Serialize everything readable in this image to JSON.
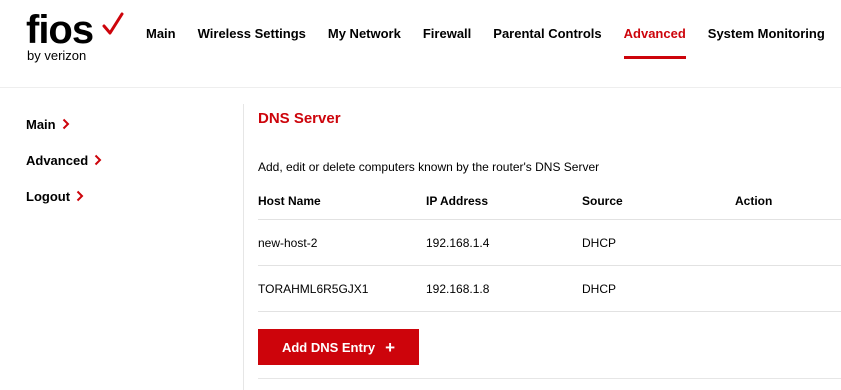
{
  "brand": {
    "logo_word": "fios",
    "logo_sub": "by verizon",
    "accent_color": "#cd040b"
  },
  "nav": {
    "items": [
      {
        "label": "Main",
        "active": false
      },
      {
        "label": "Wireless Settings",
        "active": false
      },
      {
        "label": "My Network",
        "active": false
      },
      {
        "label": "Firewall",
        "active": false
      },
      {
        "label": "Parental Controls",
        "active": false
      },
      {
        "label": "Advanced",
        "active": true
      },
      {
        "label": "System Monitoring",
        "active": false
      }
    ]
  },
  "sidebar": {
    "items": [
      {
        "label": "Main",
        "icon": "chevron-right-icon"
      },
      {
        "label": "Advanced",
        "icon": "chevron-right-icon"
      },
      {
        "label": "Logout",
        "icon": "chevron-right-icon"
      }
    ]
  },
  "main": {
    "title": "DNS Server",
    "description": "Add, edit or delete computers known by the router's DNS Server",
    "table": {
      "headers": [
        "Host Name",
        "IP Address",
        "Source",
        "Action"
      ],
      "rows": [
        {
          "host": "new-host-2",
          "ip": "192.168.1.4",
          "source": "DHCP",
          "action": ""
        },
        {
          "host": "TORAHML6R5GJX1",
          "ip": "192.168.1.8",
          "source": "DHCP",
          "action": ""
        }
      ]
    },
    "add_button": {
      "label": "Add DNS Entry",
      "icon": "plus-icon"
    }
  }
}
